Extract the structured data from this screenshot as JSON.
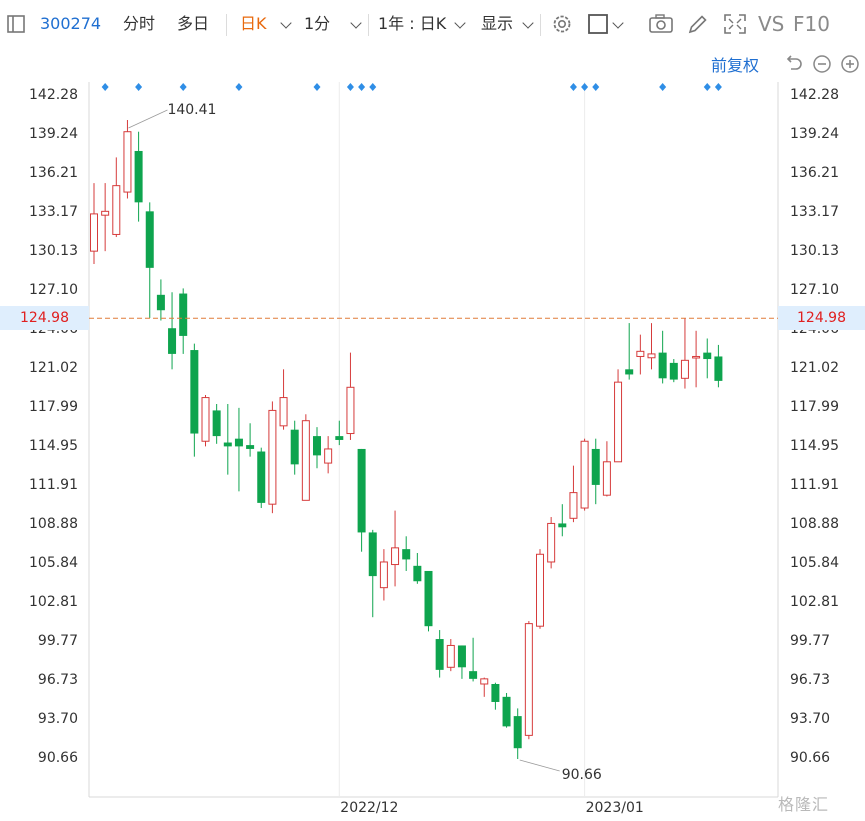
{
  "toolbar": {
    "code": "300274",
    "fenshi": "分时",
    "duori": "多日",
    "rik": "日K",
    "minute": "1分",
    "range": "1年 : 日K",
    "display": "显示",
    "vs": "VS",
    "f10": "F10"
  },
  "fuquan": "前复权",
  "watermark": "格隆汇",
  "colors": {
    "up": "#d63b3b",
    "down": "#0ea44e",
    "accent": "#1f6fd1",
    "price_line": "#e07b39",
    "price_tag_bg": "#dfeefd"
  },
  "icons": [
    "panel-toggle-icon",
    "dropdown-chevron-icon",
    "gear-icon",
    "square-icon",
    "camera-icon",
    "pencil-icon",
    "expand-icon",
    "undo-icon",
    "zoom-out-icon",
    "zoom-in-icon",
    "event-diamond-icon"
  ],
  "chart_data": {
    "type": "candlestick",
    "y_ticks": [
      "142.28",
      "139.24",
      "136.21",
      "133.17",
      "130.13",
      "127.10",
      "124.06",
      "121.02",
      "117.99",
      "114.95",
      "111.91",
      "108.88",
      "105.84",
      "102.81",
      "99.77",
      "96.73",
      "93.70",
      "90.66"
    ],
    "ylim": [
      90.66,
      142.28
    ],
    "x_labels": [
      {
        "text": "2022/12",
        "index": 22
      },
      {
        "text": "2023/01",
        "index": 44
      }
    ],
    "current_price": "124.98",
    "max_label": {
      "text": "140.41",
      "index": 3,
      "value": 140.41
    },
    "min_label": {
      "text": "90.66",
      "index": 38,
      "value": 90.66
    },
    "event_marker_indices": [
      1,
      4,
      8,
      13,
      20,
      23,
      24,
      25,
      43,
      44,
      45,
      51,
      55,
      56
    ],
    "candles": [
      {
        "o": 130.2,
        "h": 135.5,
        "l": 129.2,
        "c": 133.1
      },
      {
        "o": 133.0,
        "h": 135.5,
        "l": 130.2,
        "c": 133.3
      },
      {
        "o": 131.5,
        "h": 137.5,
        "l": 131.3,
        "c": 135.3
      },
      {
        "o": 134.8,
        "h": 140.41,
        "l": 134.3,
        "c": 139.5
      },
      {
        "o": 138.0,
        "h": 139.5,
        "l": 132.5,
        "c": 134.0
      },
      {
        "o": 133.3,
        "h": 134.0,
        "l": 125.0,
        "c": 128.9
      },
      {
        "o": 126.8,
        "h": 128.0,
        "l": 124.8,
        "c": 125.6
      },
      {
        "o": 124.2,
        "h": 127.0,
        "l": 121.0,
        "c": 122.2
      },
      {
        "o": 126.9,
        "h": 127.3,
        "l": 122.2,
        "c": 123.6
      },
      {
        "o": 122.5,
        "h": 123.0,
        "l": 114.2,
        "c": 116.0
      },
      {
        "o": 115.4,
        "h": 119.0,
        "l": 115.0,
        "c": 118.8
      },
      {
        "o": 117.8,
        "h": 118.3,
        "l": 115.2,
        "c": 115.8
      },
      {
        "o": 115.3,
        "h": 118.3,
        "l": 112.8,
        "c": 115.0
      },
      {
        "o": 115.6,
        "h": 118.0,
        "l": 111.5,
        "c": 115.0
      },
      {
        "o": 115.1,
        "h": 116.8,
        "l": 114.2,
        "c": 114.8
      },
      {
        "o": 114.6,
        "h": 114.9,
        "l": 110.2,
        "c": 110.6
      },
      {
        "o": 110.5,
        "h": 118.5,
        "l": 109.8,
        "c": 117.8
      },
      {
        "o": 116.6,
        "h": 121.0,
        "l": 116.3,
        "c": 118.8
      },
      {
        "o": 116.3,
        "h": 117.0,
        "l": 112.8,
        "c": 113.6
      },
      {
        "o": 110.8,
        "h": 117.5,
        "l": 110.8,
        "c": 117.0
      },
      {
        "o": 115.8,
        "h": 116.5,
        "l": 113.3,
        "c": 114.3
      },
      {
        "o": 113.7,
        "h": 115.8,
        "l": 112.9,
        "c": 114.8
      },
      {
        "o": 115.8,
        "h": 117.0,
        "l": 115.1,
        "c": 115.5
      },
      {
        "o": 116.0,
        "h": 122.3,
        "l": 115.5,
        "c": 119.6
      },
      {
        "o": 114.8,
        "h": 114.8,
        "l": 106.8,
        "c": 108.3
      },
      {
        "o": 108.3,
        "h": 108.5,
        "l": 101.7,
        "c": 104.9
      },
      {
        "o": 104.0,
        "h": 107.0,
        "l": 103.0,
        "c": 106.0
      },
      {
        "o": 105.8,
        "h": 110.0,
        "l": 104.1,
        "c": 107.1
      },
      {
        "o": 107.0,
        "h": 108.0,
        "l": 105.3,
        "c": 106.2
      },
      {
        "o": 105.7,
        "h": 106.7,
        "l": 104.3,
        "c": 104.5
      },
      {
        "o": 105.3,
        "h": 105.3,
        "l": 100.6,
        "c": 101.0
      },
      {
        "o": 100.0,
        "h": 100.7,
        "l": 97.0,
        "c": 97.6
      },
      {
        "o": 97.8,
        "h": 100.0,
        "l": 97.5,
        "c": 99.5
      },
      {
        "o": 99.5,
        "h": 99.5,
        "l": 96.9,
        "c": 97.8
      },
      {
        "o": 97.5,
        "h": 100.1,
        "l": 96.7,
        "c": 96.9
      },
      {
        "o": 96.5,
        "h": 97.0,
        "l": 95.5,
        "c": 96.9
      },
      {
        "o": 96.5,
        "h": 96.6,
        "l": 94.5,
        "c": 95.1
      },
      {
        "o": 95.5,
        "h": 95.8,
        "l": 93.1,
        "c": 93.2
      },
      {
        "o": 94.0,
        "h": 94.6,
        "l": 90.66,
        "c": 91.5
      },
      {
        "o": 92.5,
        "h": 101.4,
        "l": 92.2,
        "c": 101.2
      },
      {
        "o": 101.0,
        "h": 107.0,
        "l": 100.8,
        "c": 106.6
      },
      {
        "o": 106.0,
        "h": 109.5,
        "l": 105.5,
        "c": 109.0
      },
      {
        "o": 109.0,
        "h": 110.5,
        "l": 108.0,
        "c": 108.7
      },
      {
        "o": 109.4,
        "h": 113.5,
        "l": 109.1,
        "c": 111.4
      },
      {
        "o": 110.2,
        "h": 115.6,
        "l": 110.0,
        "c": 115.4
      },
      {
        "o": 114.8,
        "h": 115.6,
        "l": 110.5,
        "c": 112.0
      },
      {
        "o": 111.2,
        "h": 115.4,
        "l": 111.1,
        "c": 113.8
      },
      {
        "o": 113.8,
        "h": 121.0,
        "l": 113.8,
        "c": 120.0
      },
      {
        "o": 121.0,
        "h": 124.6,
        "l": 120.2,
        "c": 120.6
      },
      {
        "o": 122.0,
        "h": 123.7,
        "l": 120.6,
        "c": 122.4
      },
      {
        "o": 121.9,
        "h": 124.6,
        "l": 121.0,
        "c": 122.2
      },
      {
        "o": 122.3,
        "h": 124.0,
        "l": 119.9,
        "c": 120.3
      },
      {
        "o": 121.5,
        "h": 121.8,
        "l": 120.0,
        "c": 120.2
      },
      {
        "o": 120.3,
        "h": 124.98,
        "l": 119.5,
        "c": 121.7
      },
      {
        "o": 121.9,
        "h": 124.0,
        "l": 119.6,
        "c": 122.0
      },
      {
        "o": 122.3,
        "h": 123.4,
        "l": 120.3,
        "c": 121.8
      },
      {
        "o": 122.0,
        "h": 122.9,
        "l": 119.6,
        "c": 120.1
      }
    ]
  }
}
